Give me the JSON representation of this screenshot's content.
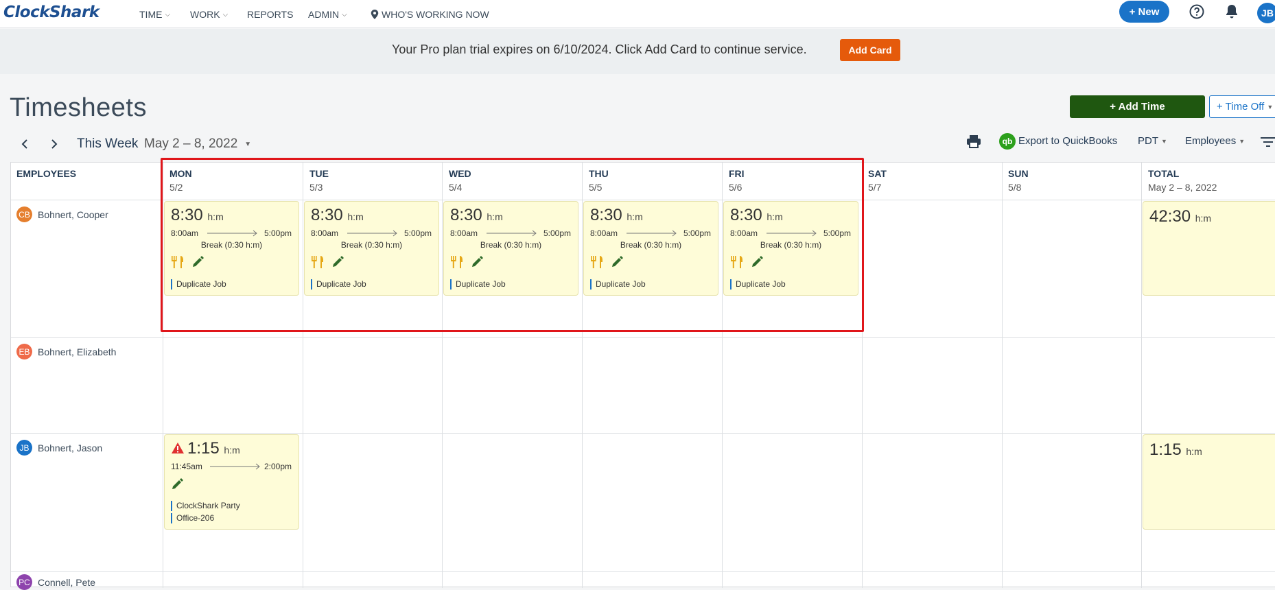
{
  "nav": {
    "logo": "ClockShark",
    "items": [
      "TIME",
      "WORK",
      "REPORTS",
      "ADMIN"
    ],
    "whos_working": "WHO'S WORKING NOW",
    "new_label": "+ New",
    "user_initials": "JB"
  },
  "banner": {
    "text": "Your Pro plan trial expires on 6/10/2024. Click Add Card to continue service.",
    "button": "Add Card"
  },
  "page": {
    "title": "Timesheets",
    "add_time": "+ Add Time",
    "time_off": "+ Time Off",
    "week_label": "This Week",
    "week_range": "May 2 – 8, 2022",
    "export_label": "Export to QuickBooks",
    "qb_badge": "qb",
    "timezone": "PDT",
    "view_filter": "Employees"
  },
  "grid": {
    "employees_header": "EMPLOYEES",
    "days": [
      {
        "day": "MON",
        "date": "5/2"
      },
      {
        "day": "TUE",
        "date": "5/3"
      },
      {
        "day": "WED",
        "date": "5/4"
      },
      {
        "day": "THU",
        "date": "5/5"
      },
      {
        "day": "FRI",
        "date": "5/6"
      },
      {
        "day": "SAT",
        "date": "5/7"
      },
      {
        "day": "SUN",
        "date": "5/8"
      }
    ],
    "total_header": "TOTAL",
    "total_range": "May 2 – 8, 2022",
    "unit": "h:m",
    "employees": [
      {
        "initials": "CB",
        "name": "Bohnert, Cooper",
        "color": "#e57f2e",
        "total": "42:30"
      },
      {
        "initials": "EB",
        "name": "Bohnert, Elizabeth",
        "color": "#ef6b4a",
        "total": ""
      },
      {
        "initials": "JB",
        "name": "Bohnert, Jason",
        "color": "#1a73c8",
        "total": "1:15"
      },
      {
        "initials": "PC",
        "name": "Connell, Pete",
        "color": "#8e44ad",
        "total": ""
      }
    ],
    "cooper_entry": {
      "duration": "8:30",
      "start": "8:00am",
      "end": "5:00pm",
      "break": "Break (0:30 h:m)",
      "job": "Duplicate Job"
    },
    "jason_entry": {
      "duration": "1:15",
      "start": "11:45am",
      "end": "2:00pm",
      "job": "ClockShark Party",
      "task": "Office-206"
    }
  }
}
